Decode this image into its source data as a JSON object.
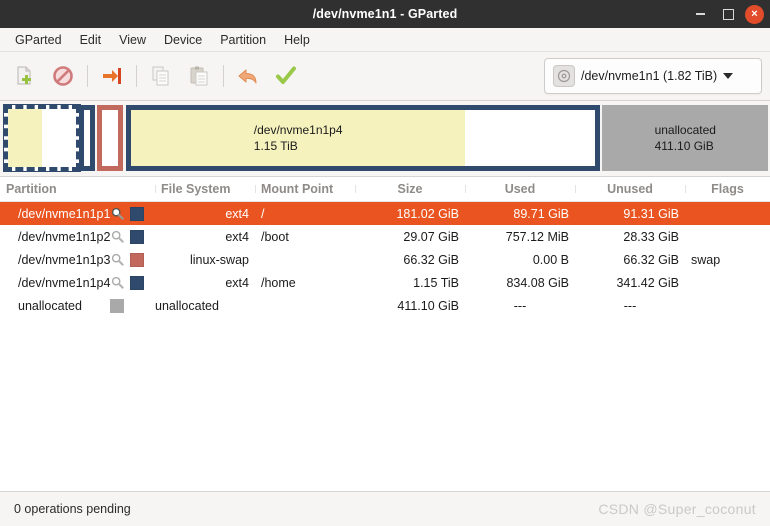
{
  "window": {
    "title": "/dev/nvme1n1 - GParted",
    "controls": {
      "minimize": "minimize",
      "maximize": "maximize",
      "close": "×"
    }
  },
  "menubar": {
    "items": [
      {
        "label": "GParted"
      },
      {
        "label": "Edit"
      },
      {
        "label": "View"
      },
      {
        "label": "Device"
      },
      {
        "label": "Partition"
      },
      {
        "label": "Help"
      }
    ]
  },
  "toolbar": {
    "buttons": [
      {
        "name": "new-partition-button",
        "icon": "new-document-icon",
        "enabled": true
      },
      {
        "name": "delete-partition-button",
        "icon": "delete-prohibition-icon",
        "enabled": true
      },
      {
        "name": "resize-move-button",
        "icon": "resize-move-arrow-icon",
        "enabled": true
      },
      {
        "name": "copy-button",
        "icon": "copy-icon",
        "enabled": false
      },
      {
        "name": "paste-button",
        "icon": "paste-icon",
        "enabled": false
      },
      {
        "name": "undo-button",
        "icon": "undo-arrow-icon",
        "enabled": true
      },
      {
        "name": "apply-button",
        "icon": "apply-check-icon",
        "enabled": true
      }
    ],
    "device_selector": {
      "icon": "disk-icon",
      "label": "/dev/nvme1n1 (1.82 TiB)",
      "caret": "chevron-down-icon"
    }
  },
  "disk_graphic": {
    "segments": [
      {
        "name": "/dev/nvme1n1p1",
        "size": "181.02 GiB",
        "type": "ext4",
        "selected": true,
        "show_label": false,
        "left_pct": 0.5,
        "width_pct": 9.9,
        "used_pct": 50
      },
      {
        "name": "/dev/nvme1n1p2",
        "size": "29.07 GiB",
        "type": "ext4",
        "selected": false,
        "show_label": false,
        "left_pct": 10.3,
        "width_pct": 2.1,
        "used_pct": 0
      },
      {
        "name": "/dev/nvme1n1p3",
        "size": "66.32 GiB",
        "type": "swap",
        "selected": false,
        "show_label": false,
        "left_pct": 12.6,
        "width_pct": 3.4,
        "used_pct": 0
      },
      {
        "name": "/dev/nvme1n1p4",
        "size": "1.15 TiB",
        "type": "ext4",
        "selected": false,
        "show_label": true,
        "left_pct": 16.4,
        "width_pct": 61.5,
        "used_pct": 72
      }
    ],
    "unallocated": {
      "name": "unallocated",
      "size": "411.10 GiB",
      "left_pct": 78.2,
      "width_pct": 21.6
    }
  },
  "table": {
    "columns": [
      {
        "key": "partition",
        "label": "Partition"
      },
      {
        "key": "filesystem",
        "label": "File System"
      },
      {
        "key": "mountpoint",
        "label": "Mount Point"
      },
      {
        "key": "size",
        "label": "Size"
      },
      {
        "key": "used",
        "label": "Used"
      },
      {
        "key": "unused",
        "label": "Unused"
      },
      {
        "key": "flags",
        "label": "Flags"
      }
    ],
    "rows": [
      {
        "partition": "/dev/nvme1n1p1",
        "has_magnifier": true,
        "swatch_color": "#2f4a6d",
        "filesystem": "ext4",
        "mountpoint": "/",
        "size": "181.02 GiB",
        "used": "89.71 GiB",
        "unused": "91.31 GiB",
        "flags": "",
        "selected": true
      },
      {
        "partition": "/dev/nvme1n1p2",
        "has_magnifier": true,
        "swatch_color": "#2f4a6d",
        "filesystem": "ext4",
        "mountpoint": "/boot",
        "size": "29.07 GiB",
        "used": "757.12 MiB",
        "unused": "28.33 GiB",
        "flags": "",
        "selected": false
      },
      {
        "partition": "/dev/nvme1n1p3",
        "has_magnifier": true,
        "swatch_color": "#c2695e",
        "filesystem": "linux-swap",
        "mountpoint": "",
        "size": "66.32 GiB",
        "used": "0.00 B",
        "unused": "66.32 GiB",
        "flags": "swap",
        "selected": false
      },
      {
        "partition": "/dev/nvme1n1p4",
        "has_magnifier": true,
        "swatch_color": "#2f4a6d",
        "filesystem": "ext4",
        "mountpoint": "/home",
        "size": "1.15 TiB",
        "used": "834.08 GiB",
        "unused": "341.42 GiB",
        "flags": "",
        "selected": false
      },
      {
        "partition": "unallocated",
        "has_magnifier": false,
        "swatch_color": "#a9a9a9",
        "filesystem": "unallocated",
        "mountpoint": "",
        "size": "411.10 GiB",
        "used": "---",
        "unused": "---",
        "flags": "",
        "selected": false
      }
    ]
  },
  "statusbar": {
    "text": "0 operations pending",
    "watermark": "CSDN @Super_coconut"
  },
  "colors": {
    "selection": "#e95420",
    "ext4": "#2f4a6d",
    "swap": "#c2695e",
    "unallocated": "#a9a9a9",
    "used_fill": "#f5f2be",
    "titlebar": "#303030",
    "chrome": "#f6f5f4"
  }
}
